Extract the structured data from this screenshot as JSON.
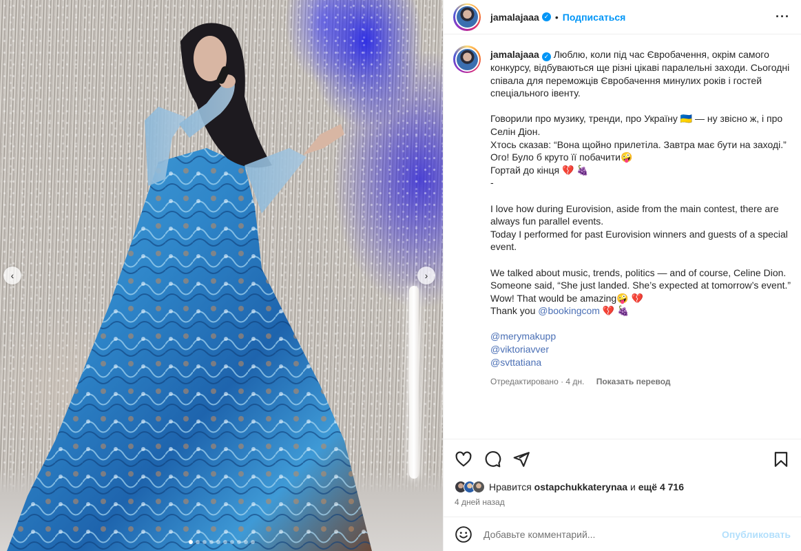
{
  "media": {
    "carousel_dots": 10,
    "active_dot": 0,
    "prev_arrow": "‹",
    "next_arrow": "›"
  },
  "header": {
    "username": "jamalajaaa",
    "separator": "•",
    "follow_label": "Подписаться",
    "more_label": "···"
  },
  "caption": {
    "username": "jamalajaaa",
    "first_line": "Люблю, коли під час Євробачення, окрім самого конкурсу, відбуваються ще різні цікаві паралельні заходи. Сьогодні співала для переможців Євробачення минулих років і гостей спеціального івенту.",
    "p2": "Говорили про музику, тренди, про Україну 🇺🇦 — ну звісно ж, і про Селін Діон.\nХтось сказав: “Вона щойно прилетіла. Завтра має бути на заході.”\nОго! Було б круто її побачити🤪\nГортай до кінця 💔 🍇\n-",
    "p3": "I love how during Eurovision, aside from the main contest, there are always fun parallel events.\nToday I performed for past Eurovision winners and guests of a special event.",
    "p4": "We talked about music, trends, politics — and of course, Celine Dion.\nSomeone said, “She just landed. She’s expected at tomorrow’s event.”\nWow! That would be amazing🤪 💔",
    "thanks_prefix": "Thank you ",
    "thanks_mention": "@bookingcom",
    "thanks_suffix": " 💔 🍇",
    "mentions": [
      "@merymakupp",
      "@viktoriavver",
      "@svttatiana"
    ],
    "edited": "Отредактировано · 4 дн.",
    "translate": "Показать перевод"
  },
  "actions": {
    "like_icon": "heart-outline-icon",
    "comment_icon": "comment-bubble-icon",
    "share_icon": "paper-plane-icon",
    "save_icon": "bookmark-icon"
  },
  "likes": {
    "prefix": "Нравится ",
    "user": "ostapchukkaterynaa",
    "middle": " и ",
    "count": "ещё 4 716"
  },
  "time_ago": "4 дней назад",
  "comment": {
    "placeholder": "Добавьте комментарий...",
    "post_label": "Опубликовать",
    "emoji_icon": "smiley-icon"
  },
  "colors": {
    "accent_blue": "#0095f6",
    "mention_blue": "#4a6fb5",
    "muted": "#737373",
    "post_disabled": "#b2dffc"
  }
}
